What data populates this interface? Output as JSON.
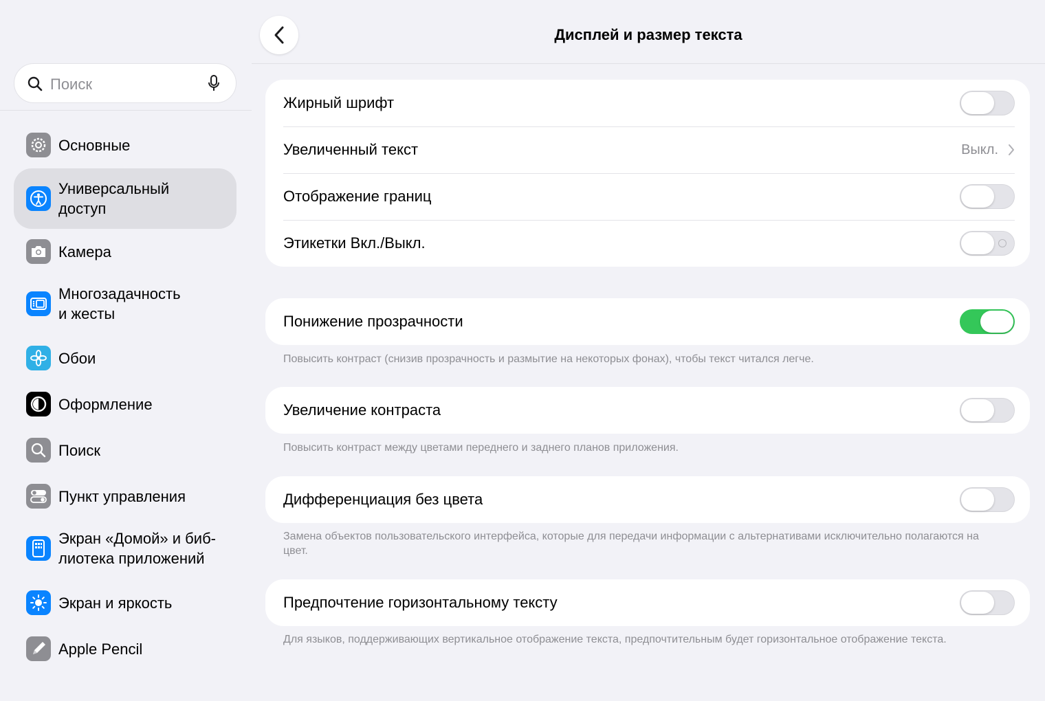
{
  "search": {
    "placeholder": "Поиск"
  },
  "sidebar": {
    "items": [
      {
        "label": "Основные",
        "icon": "gear-icon",
        "color": "#8e8e93"
      },
      {
        "label": "Универсальный\nдоступ",
        "icon": "accessibility-icon",
        "color": "#0a84ff",
        "active": true
      },
      {
        "label": "Камера",
        "icon": "camera-icon",
        "color": "#8e8e93"
      },
      {
        "label": "Многозадачность\nи жесты",
        "icon": "multitasking-icon",
        "color": "#0a84ff"
      },
      {
        "label": "Обои",
        "icon": "flower-icon",
        "color": "#30b0e6"
      },
      {
        "label": "Оформление",
        "icon": "appearance-icon",
        "color": "#000000"
      },
      {
        "label": "Поиск",
        "icon": "search-icon",
        "color": "#8e8e93"
      },
      {
        "label": "Пункт управления",
        "icon": "toggles-icon",
        "color": "#8e8e93"
      },
      {
        "label": "Экран «Домой» и биб-\nлиотека приложений",
        "icon": "home-screen-icon",
        "color": "#0a84ff"
      },
      {
        "label": "Экран и яркость",
        "icon": "sun-icon",
        "color": "#0a84ff"
      },
      {
        "label": "Apple Pencil",
        "icon": "pencil-icon",
        "color": "#8e8e93"
      }
    ]
  },
  "header": {
    "title": "Дисплей и размер текста"
  },
  "main": {
    "group1": {
      "bold_text": {
        "label": "Жирный шрифт",
        "on": false
      },
      "larger_text": {
        "label": "Увеличенный текст",
        "value": "Выкл."
      },
      "button_shapes": {
        "label": "Отображение границ",
        "on": false
      },
      "on_off_labels": {
        "label": "Этикетки Вкл./Выкл.",
        "on": false
      }
    },
    "reduce_transparency": {
      "label": "Понижение прозрачности",
      "on": true,
      "footnote": "Повысить контраст (снизив прозрачность и размытие на некоторых фонах), чтобы текст читался легче."
    },
    "increase_contrast": {
      "label": "Увеличение контраста",
      "on": false,
      "footnote": "Повысить контраст между цветами переднего и заднего планов приложения."
    },
    "differentiate": {
      "label": "Дифференциация без цвета",
      "on": false,
      "footnote": "Замена объектов пользовательского интерфейса, которые для передачи информации с альтернативами исключительно полагаются на цвет."
    },
    "horizontal_text": {
      "label": "Предпочтение горизонтальному тексту",
      "on": false,
      "footnote": "Для языков, поддерживающих вертикальное отображение текста, предпочтительным будет горизонтальное отображение текста."
    }
  },
  "colors": {
    "accent": "#0a84ff",
    "toggle_on": "#34c759",
    "background": "#f2f2f7"
  }
}
